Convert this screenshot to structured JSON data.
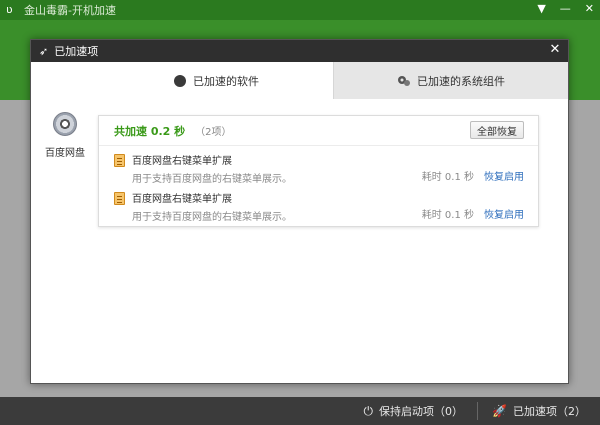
{
  "app": {
    "title": "金山毒霸-开机加速",
    "footer": {
      "keep_label": "保持启动项（0）",
      "accelerated_label": "已加速项（2）"
    }
  },
  "dialog": {
    "title": "已加速项",
    "tabs": [
      {
        "label": "已加速的软件",
        "active": true
      },
      {
        "label": "已加速的系统组件",
        "active": false
      }
    ],
    "left_app_label": "百度网盘",
    "summary": {
      "total": "共加速 0.2 秒",
      "count": "（2项）",
      "restore_all": "全部恢复"
    },
    "items": [
      {
        "name": "百度网盘右键菜单扩展",
        "desc": "用于支持百度网盘的右键菜单展示。",
        "time": "耗时 0.1 秒",
        "action": "恢复启用"
      },
      {
        "name": "百度网盘右键菜单扩展",
        "desc": "用于支持百度网盘的右键菜单展示。",
        "time": "耗时 0.1 秒",
        "action": "恢复启用"
      }
    ]
  },
  "colors": {
    "accent_green": "#3a9a19",
    "link_blue": "#2f6fbd",
    "title_bar": "#2f2f2f"
  }
}
